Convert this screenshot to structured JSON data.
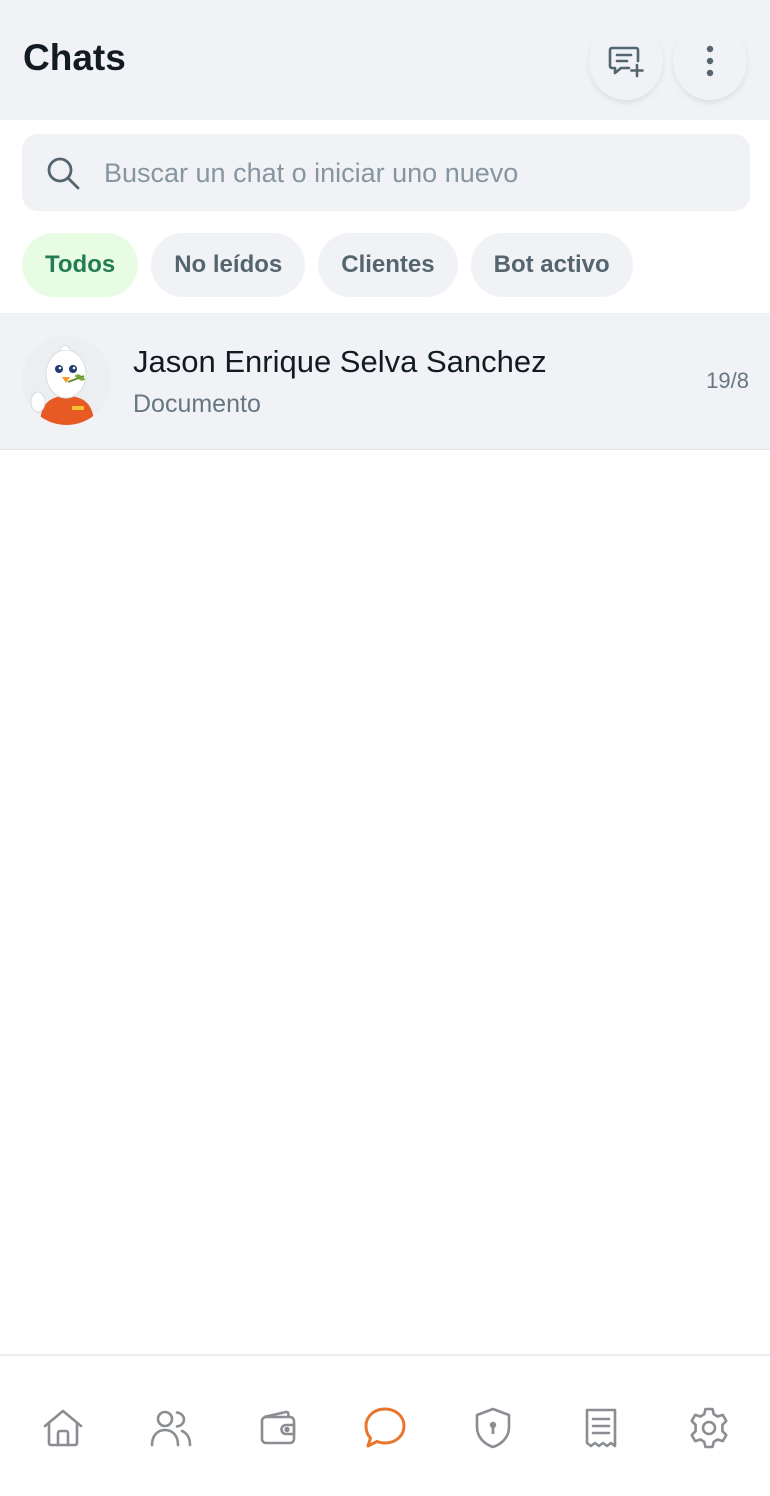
{
  "header": {
    "title": "Chats",
    "new_chat_icon": "new-chat-icon",
    "menu_icon": "kebab-menu-icon"
  },
  "search": {
    "placeholder": "Buscar un chat o iniciar uno nuevo",
    "value": ""
  },
  "filters": [
    {
      "label": "Todos",
      "active": true
    },
    {
      "label": "No leídos",
      "active": false
    },
    {
      "label": "Clientes",
      "active": false
    },
    {
      "label": "Bot activo",
      "active": false
    }
  ],
  "chats": [
    {
      "name": "Jason Enrique Selva Sanchez",
      "preview": "Documento",
      "time": "19/8",
      "avatar": "mascot-avatar"
    }
  ],
  "bottom_nav": [
    {
      "icon": "home-icon",
      "active": false
    },
    {
      "icon": "users-icon",
      "active": false
    },
    {
      "icon": "wallet-icon",
      "active": false
    },
    {
      "icon": "chat-icon",
      "active": true
    },
    {
      "icon": "shield-icon",
      "active": false
    },
    {
      "icon": "receipt-icon",
      "active": false
    },
    {
      "icon": "gear-icon",
      "active": false
    }
  ],
  "colors": {
    "accent": "#e8762c",
    "active_chip_bg": "#e7fce3",
    "active_chip_text": "#237c52",
    "inactive_icon": "#8a8d91"
  }
}
